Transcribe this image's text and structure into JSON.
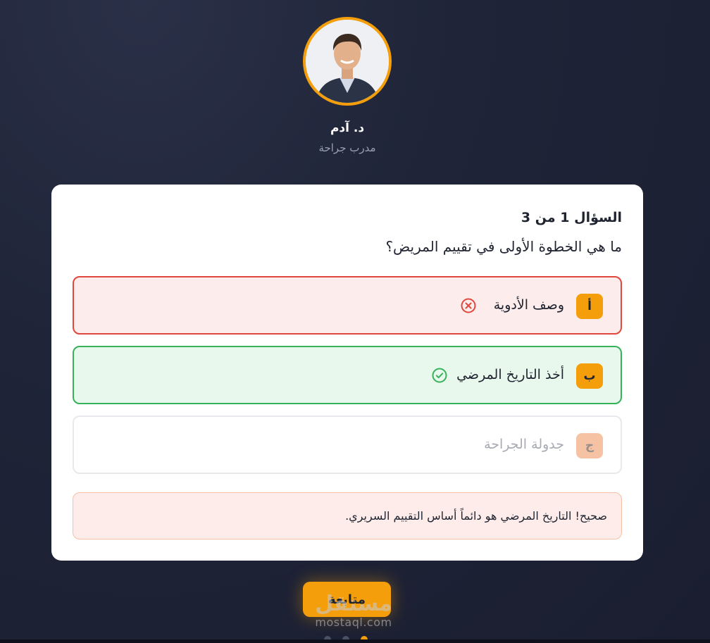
{
  "trainer": {
    "name": "د. آدم",
    "role": "مدرب جراحة",
    "avatar_icon": "person-photo"
  },
  "quiz": {
    "counter": "السؤال 1 من 3",
    "question": "ما هي الخطوة الأولى في تقييم المريض؟",
    "options": [
      {
        "letter": "أ",
        "text": "وصف الأدوية",
        "state": "wrong",
        "icon": "x-circle-icon"
      },
      {
        "letter": "ب",
        "text": "أخذ التاريخ المرضي",
        "state": "correct",
        "icon": "check-circle-icon"
      },
      {
        "letter": "ج",
        "text": "جدولة الجراحة",
        "state": "disabled",
        "icon": ""
      }
    ],
    "feedback": "صحيح! التاريخ المرضي هو دائماً أساس التقييم السريري."
  },
  "actions": {
    "continue_label": "متابعة"
  },
  "watermark": {
    "arabic": "مستقل",
    "latin": "mostaql.com"
  },
  "progress": {
    "current": 3,
    "total": 3
  },
  "colors": {
    "accent": "#f59e0b",
    "wrong_border": "#e0473d",
    "wrong_bg": "#fdecec",
    "correct_border": "#35b25a",
    "correct_bg": "#e9f8ec",
    "background": "#1f2438"
  }
}
